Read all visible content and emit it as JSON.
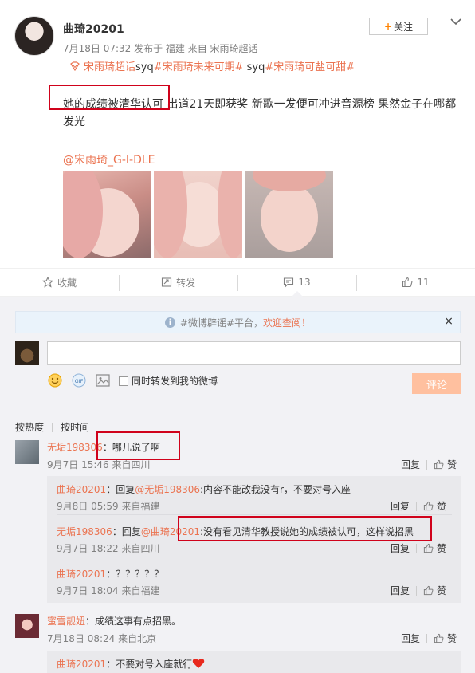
{
  "post": {
    "author": "曲琦20201",
    "meta": "7月18日 07:32 发布于 福建 来自 宋雨琦超话",
    "follow_label": "关注",
    "topics": [
      {
        "text": "宋雨琦超话",
        "link": true
      },
      {
        "text": "syq",
        "link": false
      },
      {
        "text": "#宋雨琦未来可期#",
        "link": true
      },
      {
        "text": " syq",
        "link": false
      },
      {
        "text": "#宋雨琦可盐可甜#",
        "link": true
      }
    ],
    "text": "她的成绩被清华认可 出道21天即获奖 新歌一发便可冲进音源榜 果然金子在哪都发光",
    "mention": "@宋雨琦_G-I-DLE"
  },
  "actions": {
    "favorite": "收藏",
    "repost": "转发",
    "comment": "13",
    "like": "11"
  },
  "comment_box": {
    "notice_prefix": "#微博辟谣#平台，",
    "notice_link": "欢迎查阅！",
    "sync_label": "同时转发到我的微博",
    "submit_label": "评论"
  },
  "sort": {
    "hot": "按热度",
    "time": "按时间"
  },
  "comments": [
    {
      "user": "无垢198306",
      "text": "：哪儿说了啊",
      "time": "9月7日 15:46 来自四川",
      "reply_label": "回复",
      "like_label": "赞",
      "replies": [
        {
          "user": "曲琦20201",
          "prefix": "：回复",
          "target": "@无垢198306",
          "text": ":内容不能改我没有r，不要对号入座",
          "time": "9月8日 05:59 来自福建"
        },
        {
          "user": "无垢198306",
          "prefix": "：回复",
          "target": "@曲琦20201",
          "text": ":没有看见清华教授说她的成绩被认可，这样说招黑",
          "time": "9月7日 18:22 来自四川"
        },
        {
          "user": "曲琦20201",
          "prefix": "：",
          "target": "",
          "text": "？？？？？",
          "time": "9月7日 18:04 来自福建"
        }
      ]
    },
    {
      "user": "蜜雪靓妞",
      "text": "：成绩这事有点招黑。",
      "time": "7月18日 08:24 来自北京",
      "reply_label": "回复",
      "like_label": "赞",
      "replies": [
        {
          "user": "曲琦20201",
          "prefix": "：",
          "target": "",
          "text": "不要对号入座就行",
          "time": ""
        }
      ]
    }
  ]
}
